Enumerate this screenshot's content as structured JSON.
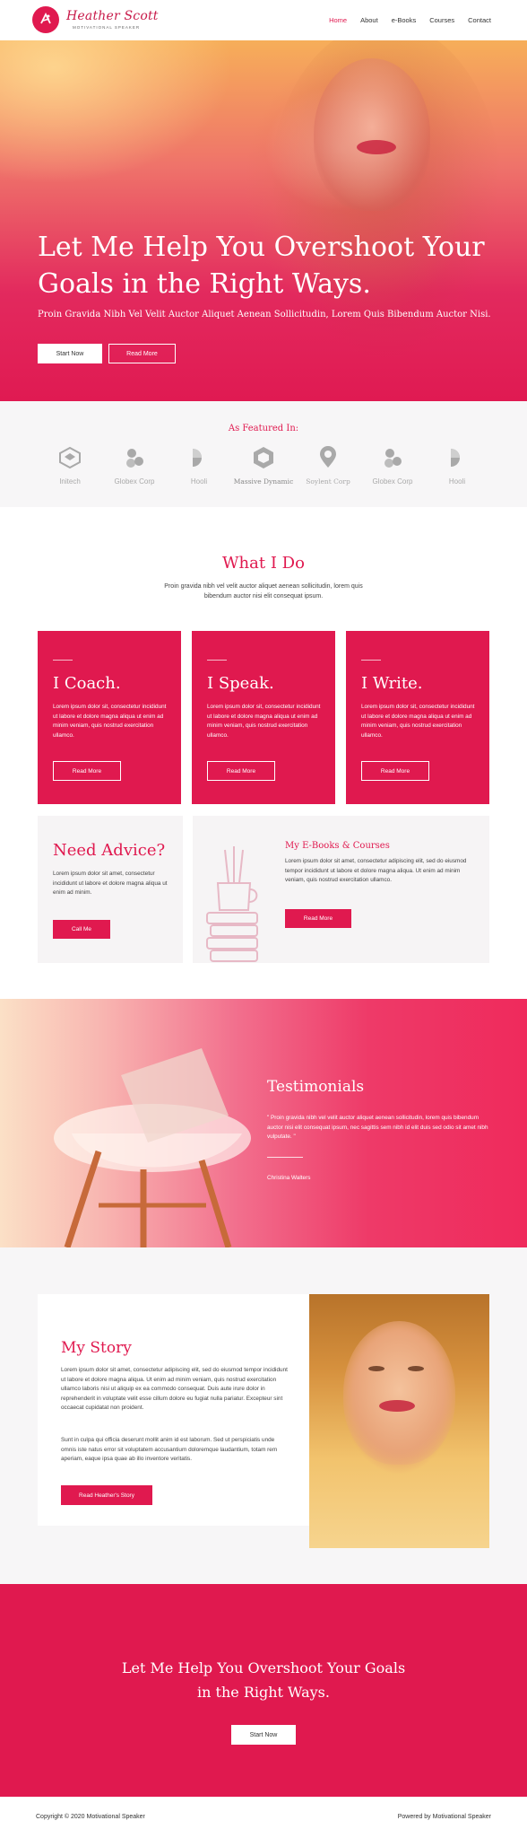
{
  "header": {
    "brand_name": "Heather Scott",
    "brand_tagline": "MOTIVATIONAL SPEAKER",
    "nav": [
      {
        "label": "Home",
        "active": true
      },
      {
        "label": "About"
      },
      {
        "label": "e-Books"
      },
      {
        "label": "Courses"
      },
      {
        "label": "Contact"
      }
    ]
  },
  "hero": {
    "title": "Let Me Help You Overshoot Your Goals in the Right Ways.",
    "subtitle": "Proin Gravida Nibh Vel Velit Auctor Aliquet Aenean Sollicitudin, Lorem Quis Bibendum Auctor Nisi.",
    "primary_button": "Start Now",
    "secondary_button": "Read More"
  },
  "featured": {
    "title": "As Featured In:",
    "logos": [
      "Initech",
      "Globex Corp",
      "Hooli",
      "Massive Dynamic",
      "Soylent Corp",
      "Globex Corp",
      "Hooli"
    ]
  },
  "what_i_do": {
    "title": "What I Do",
    "intro": "Proin gravida nibh vel velit auctor aliquet aenean sollicitudin, lorem quis bibendum auctor nisi elit consequat ipsum.",
    "cards": [
      {
        "title": "I Coach.",
        "text": "Lorem ipsum dolor sit, consectetur incididunt ut labore et dolore magna aliqua ut enim ad minim veniam, quis nostrud exercitation ullamco.",
        "button": "Read More"
      },
      {
        "title": "I Speak.",
        "text": "Lorem ipsum dolor sit, consectetur incididunt ut labore et dolore magna aliqua ut enim ad minim veniam, quis nostrud exercitation ullamco.",
        "button": "Read More"
      },
      {
        "title": "I Write.",
        "text": "Lorem ipsum dolor sit, consectetur incididunt ut labore et dolore magna aliqua ut enim ad minim veniam, quis nostrud exercitation ullamco.",
        "button": "Read More"
      }
    ],
    "advice": {
      "title": "Need Advice?",
      "text": "Lorem ipsum dolor sit amet, consectetur incididunt ut labore et dolore magna aliqua ut enim ad minim.",
      "button": "Call Me"
    },
    "ebooks": {
      "title": "My E-Books & Courses",
      "text": "Lorem ipsum dolor sit amet, consectetur adipiscing elit, sed do eiusmod tempor incididunt ut labore et dolore magna aliqua. Ut enim ad minim veniam, quis nostrud exercitation ullamco.",
      "button": "Read More"
    }
  },
  "testimonials": {
    "title": "Testimonials",
    "quote": "\" Proin gravida nibh vel velit auctor aliquet aenean sollicitudin, lorem quis bibendum auctor nisi elit consequat ipsum, nec sagittis sem nibh id elit duis sed odio sit amet nibh vulputate. \"",
    "author": "Christina Walters"
  },
  "story": {
    "title": "My Story",
    "para1": "Lorem ipsum dolor sit amet, consectetur adipiscing elit, sed do eiusmod tempor incididunt ut labore et dolore magna aliqua. Ut enim ad minim veniam, quis nostrud exercitation ullamco laboris nisi ut aliquip ex ea commodo consequat. Duis aute irure dolor in reprehenderit in voluptate velit esse cillum dolore eu fugiat nulla pariatur. Excepteur sint occaecat cupidatat non proident.",
    "para2": "Sunt in culpa qui officia deserunt mollit anim id est laborum. Sed ut perspiciatis unde omnis iste natus error sit voluptatem accusantium doloremque laudantium, totam rem aperiam, eaque ipsa quae ab illo inventore veritatis.",
    "button": "Read Heather's Story"
  },
  "cta": {
    "title": "Let Me Help You Overshoot Your Goals in the Right Ways.",
    "button": "Start Now"
  },
  "footer": {
    "copyright": "Copyright © 2020 Motivational Speaker",
    "powered": "Powered by Motivational Speaker"
  },
  "colors": {
    "accent": "#e0194f",
    "light_bg": "#f7f6f7"
  }
}
